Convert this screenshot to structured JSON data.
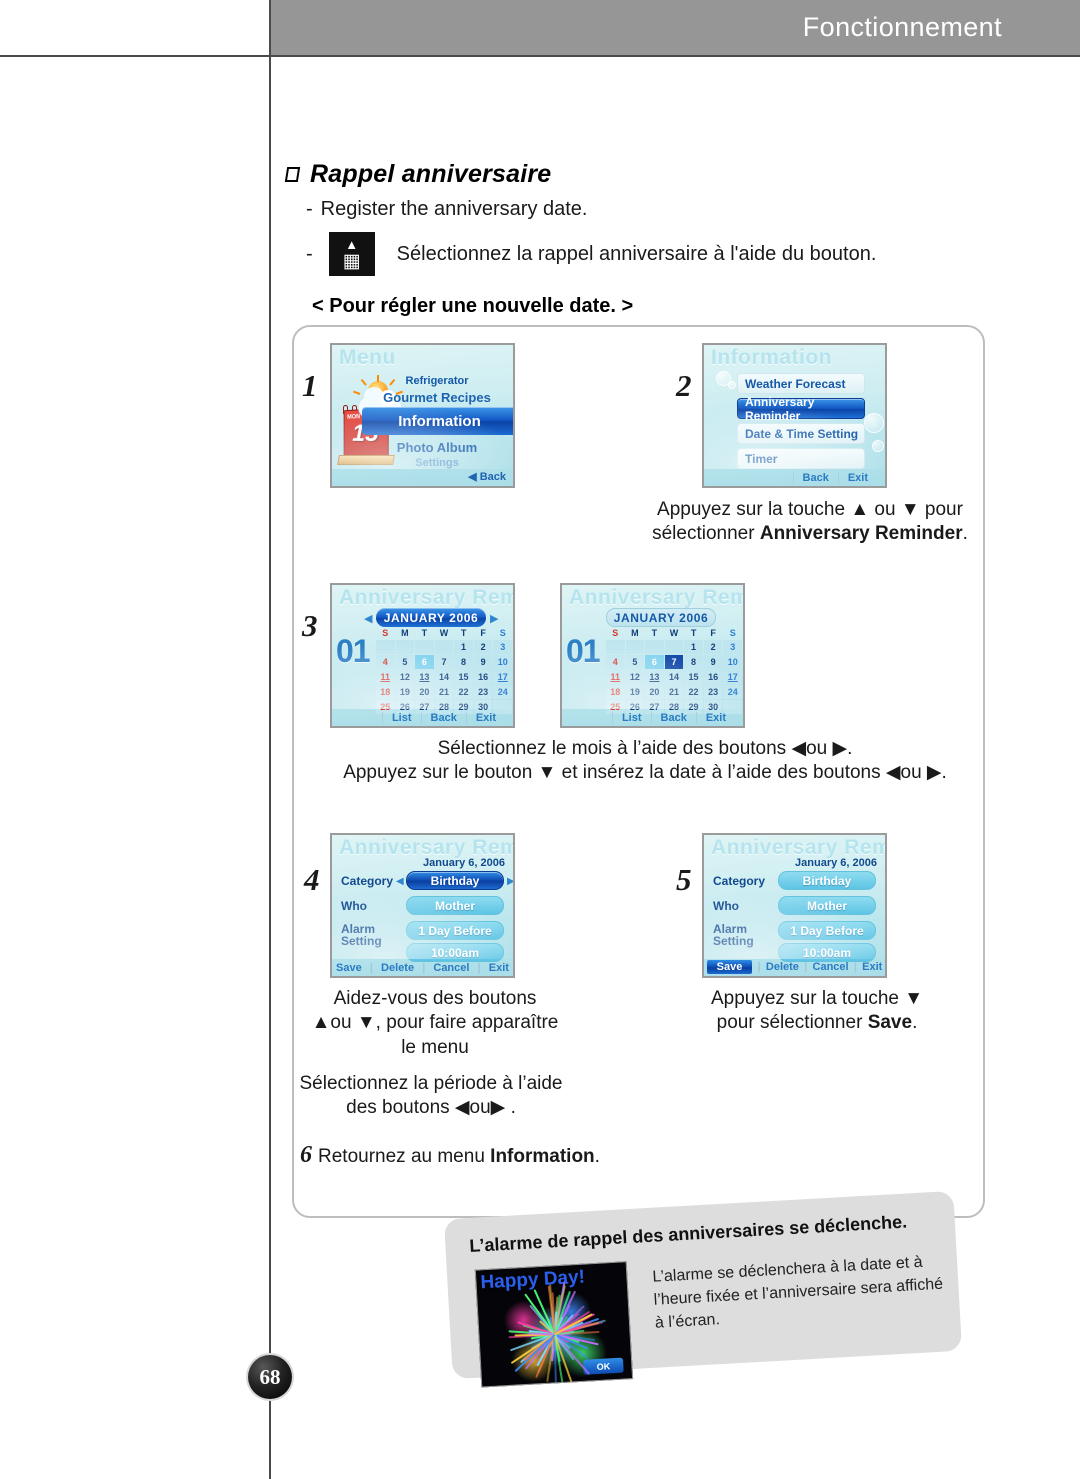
{
  "header": {
    "title": "Fonctionnement"
  },
  "page_number": "68",
  "section": {
    "title": "Rappel anniversaire",
    "bullets": [
      "Register the anniversary date.",
      "Sélectionnez la rappel anniversaire à l'aide du bouton."
    ],
    "button_icon": "calendar-icon",
    "subhead": "< Pour régler une nouvelle date. >"
  },
  "screens": {
    "menu": {
      "step": "1",
      "title": "Menu",
      "items": [
        "Refrigerator",
        "Gourmet Recipes",
        "Information",
        "Photo Album",
        "Settings"
      ],
      "selected": "Information",
      "back": "Back",
      "icon_day": "15",
      "icon_weekday": "MON"
    },
    "information": {
      "step": "2",
      "title": "Information",
      "items": [
        "Weather Forecast",
        "Anniversary Reminder",
        "Date & Time Setting",
        "Timer"
      ],
      "selected": "Anniversary Reminder",
      "footer": [
        "Back",
        "Exit"
      ]
    },
    "calendar_a": {
      "step": "3",
      "title": "Anniversary Reminder",
      "month_label": "JANUARY 2006",
      "month_number": "01",
      "weekdays": [
        "S",
        "M",
        "T",
        "W",
        "T",
        "F",
        "S"
      ],
      "leading_blanks": 0,
      "days": [
        1,
        2,
        3,
        4,
        5,
        6,
        7,
        8,
        9,
        10,
        11,
        12,
        13,
        14,
        15,
        16,
        17,
        18,
        19,
        20,
        21,
        22,
        23,
        24,
        25,
        26,
        27,
        28,
        29,
        30
      ],
      "first_day_column": 4,
      "underlined": [
        11,
        13,
        17
      ],
      "highlight_light": 6,
      "highlight_dark": null,
      "footer": [
        "List",
        "Back",
        "Exit"
      ]
    },
    "calendar_b": {
      "step": "",
      "title": "Anniversary Reminder",
      "month_label": "JANUARY 2006",
      "month_number": "01",
      "weekdays": [
        "S",
        "M",
        "T",
        "W",
        "T",
        "F",
        "S"
      ],
      "days": [
        1,
        2,
        3,
        4,
        5,
        6,
        7,
        8,
        9,
        10,
        11,
        12,
        13,
        14,
        15,
        16,
        17,
        18,
        19,
        20,
        21,
        22,
        23,
        24,
        25,
        26,
        27,
        28,
        29,
        30
      ],
      "first_day_column": 4,
      "underlined": [
        11,
        13,
        17
      ],
      "highlight_light": 6,
      "highlight_dark": 7,
      "footer": [
        "List",
        "Back",
        "Exit"
      ]
    },
    "detail_a": {
      "step": "4",
      "title": "Anniversary Reminder",
      "date": "January 6, 2006",
      "rows": [
        {
          "label": "Category",
          "value": "Birthday",
          "selected": true
        },
        {
          "label": "Who",
          "value": "Mother",
          "selected": false
        },
        {
          "label": "Alarm Setting",
          "value": "1 Day Before",
          "selected": false
        },
        {
          "label": "",
          "value": "10:00am",
          "selected": false
        }
      ],
      "footer": [
        "Save",
        "Delete",
        "Cancel",
        "Exit"
      ],
      "footer_selected": null
    },
    "detail_b": {
      "step": "5",
      "title": "Anniversary Reminder",
      "date": "January 6, 2006",
      "rows": [
        {
          "label": "Category",
          "value": "Birthday",
          "selected": false
        },
        {
          "label": "Who",
          "value": "Mother",
          "selected": false
        },
        {
          "label": "Alarm Setting",
          "value": "1 Day Before",
          "selected": false
        },
        {
          "label": "",
          "value": "10:00am",
          "selected": false
        }
      ],
      "footer": [
        "Save",
        "Delete",
        "Cancel",
        "Exit"
      ],
      "footer_selected": "Save"
    }
  },
  "captions": {
    "step2_line1": "Appuyez sur la touche ▲ ou ▼ pour",
    "step2_line2_pre": "sélectionner ",
    "step2_line2_bold": "Anniversary Reminder",
    "step2_line2_post": ".",
    "step3_line1": "Sélectionnez le mois à l’aide des boutons ◀ou ▶.",
    "step3_line2": "Appuyez sur le bouton ▼ et insérez la date à l’aide des boutons ◀ou ▶.",
    "step4_line1": "Aidez-vous des boutons",
    "step4_line2": "▲ou ▼, pour faire apparaître",
    "step4_line3": "le menu",
    "step4b_line1": "Sélectionnez la période à l’aide",
    "step4b_line2": "des boutons ◀ou▶ .",
    "step5_line1": "Appuyez sur la touche ▼",
    "step5_line2_pre": "pour sélectionner ",
    "step5_line2_bold": "Save",
    "step5_line2_post": ".",
    "step6_number": "6",
    "step6_pre": "Retournez au menu ",
    "step6_bold": "Information",
    "step6_post": "."
  },
  "note": {
    "title": "L’alarme de rappel des anniversaires se déclenche.",
    "body": "L’alarme se déclenchera à la date et à l’heure fixée et l’anniversaire sera affiché à l’écran.",
    "image_caption": "Happy Day!",
    "ok_label": "OK"
  }
}
